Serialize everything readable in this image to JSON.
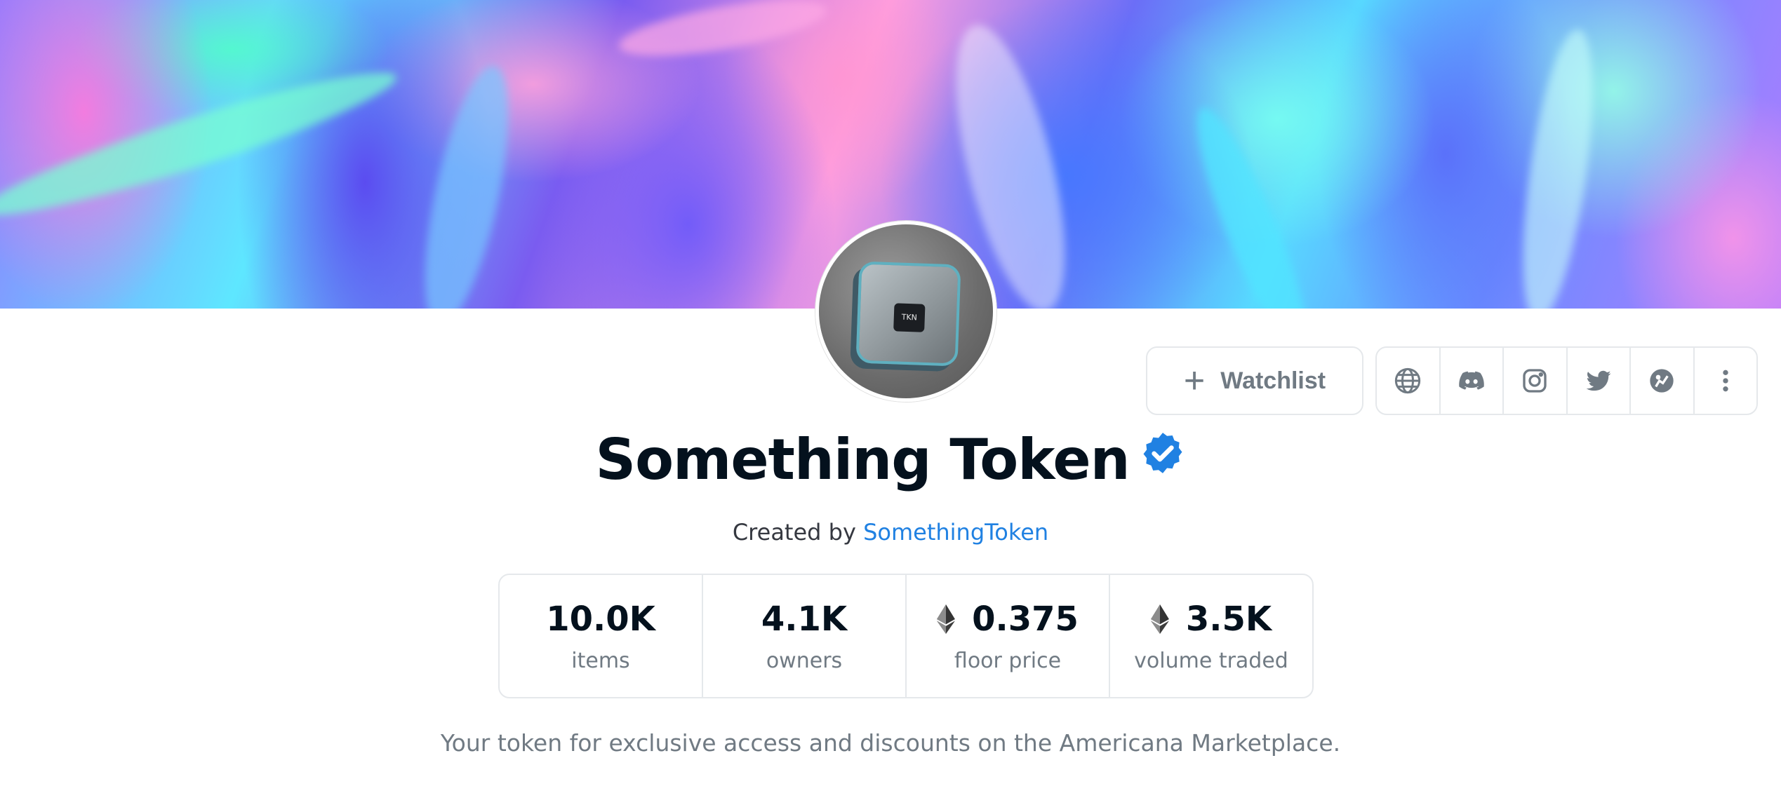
{
  "collection": {
    "name": "Something Token",
    "created_by_prefix": "Created by",
    "creator": "SomethingToken",
    "description": "Your token for exclusive access and discounts on the Americana Marketplace."
  },
  "actions": {
    "watchlist_label": "Watchlist"
  },
  "social_links": [
    {
      "icon": "globe-icon"
    },
    {
      "icon": "discord-icon"
    },
    {
      "icon": "instagram-icon"
    },
    {
      "icon": "twitter-icon"
    },
    {
      "icon": "coingecko-icon"
    },
    {
      "icon": "more-vertical-icon"
    }
  ],
  "stats": [
    {
      "value": "10.0K",
      "label": "items",
      "eth": false
    },
    {
      "value": "4.1K",
      "label": "owners",
      "eth": false
    },
    {
      "value": "0.375",
      "label": "floor price",
      "eth": true
    },
    {
      "value": "3.5K",
      "label": "volume traded",
      "eth": true
    }
  ],
  "colors": {
    "link": "#2081e2",
    "verified_badge": "#2081e2",
    "text_primary": "#04111d",
    "text_secondary": "#707a83"
  }
}
